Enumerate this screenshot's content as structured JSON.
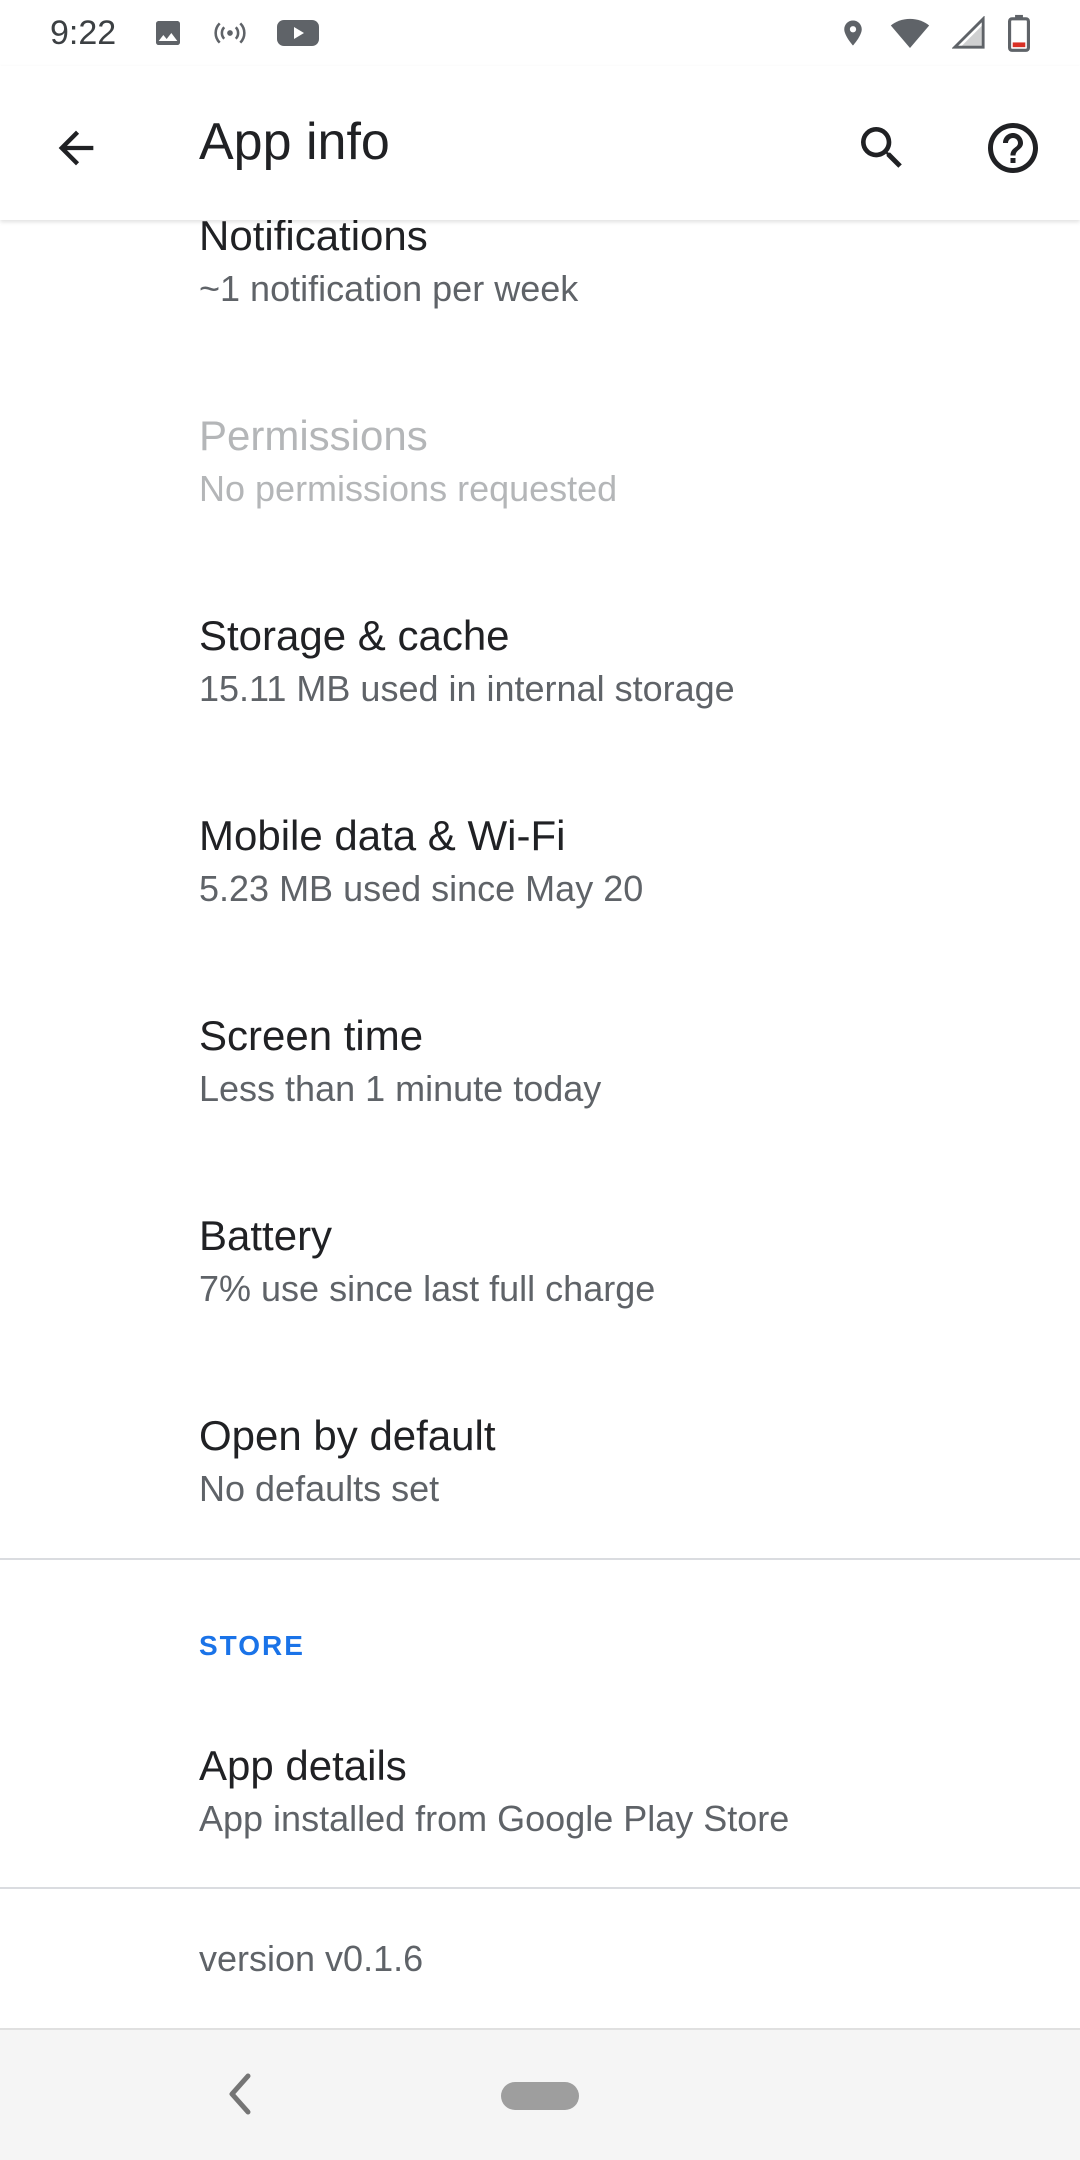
{
  "status_bar": {
    "time": "9:22",
    "left_icons": [
      "image-icon",
      "hotspot-icon",
      "youtube-icon"
    ],
    "right_icons": [
      "location-icon",
      "wifi-icon",
      "cellular-signal-icon",
      "battery-icon"
    ],
    "battery_accent_color": "#d93025"
  },
  "app_bar": {
    "title": "App info",
    "back_icon": "arrow-back-icon",
    "search_icon": "search-icon",
    "help_icon": "help-icon"
  },
  "items": [
    {
      "title": "Notifications",
      "subtitle": "~1 notification per week",
      "enabled": true
    },
    {
      "title": "Permissions",
      "subtitle": "No permissions requested",
      "enabled": false
    },
    {
      "title": "Storage & cache",
      "subtitle": "15.11 MB used in internal storage",
      "enabled": true
    },
    {
      "title": "Mobile data & Wi-Fi",
      "subtitle": "5.23 MB used since May 20",
      "enabled": true
    },
    {
      "title": "Screen time",
      "subtitle": "Less than 1 minute today",
      "enabled": true
    },
    {
      "title": "Battery",
      "subtitle": "7% use since last full charge",
      "enabled": true
    },
    {
      "title": "Open by default",
      "subtitle": "No defaults set",
      "enabled": true
    }
  ],
  "store_section": {
    "header": "STORE",
    "header_color": "#1a73e8",
    "item": {
      "title": "App details",
      "subtitle": "App installed from Google Play Store"
    }
  },
  "version": "version v0.1.6",
  "nav_bar": {
    "back_icon": "nav-back-icon",
    "home_icon": "home-pill-icon"
  }
}
